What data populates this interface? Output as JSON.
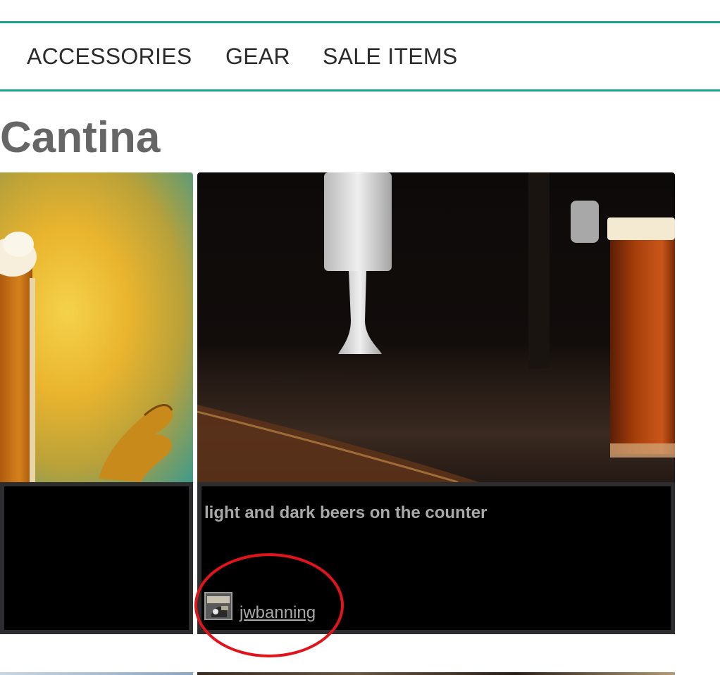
{
  "nav": {
    "items": [
      {
        "label": "ACCESSORIES"
      },
      {
        "label": "GEAR"
      },
      {
        "label": "SALE ITEMS"
      }
    ]
  },
  "page": {
    "title": "Cantina"
  },
  "cards": [
    {
      "caption": "",
      "author": ""
    },
    {
      "caption": "light and dark beers on the counter",
      "author": "jwbanning"
    }
  ],
  "colors": {
    "accent": "#1aa58c",
    "title": "#666666",
    "caption_bg": "#000000",
    "caption_border": "#2d2d2f",
    "caption_text": "#a8a8a8",
    "annotation": "#e0141a"
  }
}
